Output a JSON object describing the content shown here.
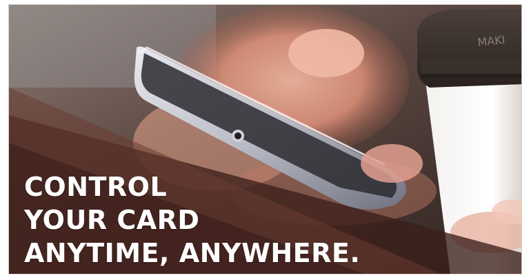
{
  "banner": {
    "headline_lines": [
      "CONTROL",
      "YOUR CARD",
      "ANYTIME, ANYWHERE."
    ],
    "cup_lid_text": "MAKI",
    "colors": {
      "overlay_dark": "#3b1f1a",
      "overlay_mid": "#6a3c32",
      "headline": "#ffffff"
    }
  }
}
